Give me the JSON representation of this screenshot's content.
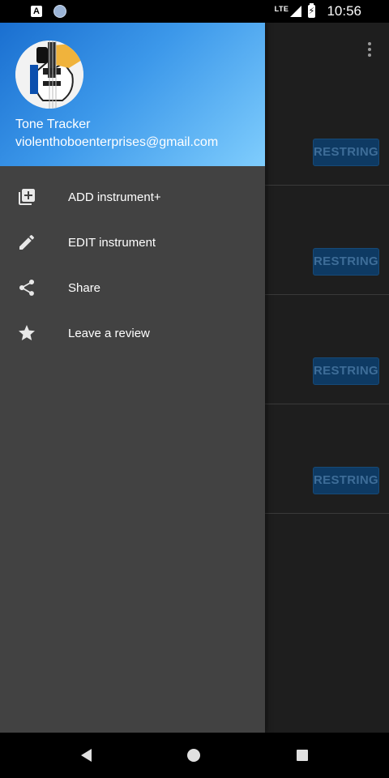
{
  "status_bar": {
    "time": "10:56",
    "network": "LTE",
    "icons": [
      "notification-a-icon",
      "sync-circle-icon",
      "lte-icon",
      "signal-icon",
      "battery-charging-icon"
    ]
  },
  "background_app": {
    "rows": [
      {
        "button_label": "RESTRING"
      },
      {
        "button_label": "RESTRING"
      },
      {
        "button_label": "RESTRING"
      },
      {
        "button_label": "RESTRING"
      }
    ],
    "overflow_menu_icon": "more-vert-icon"
  },
  "drawer": {
    "header": {
      "app_name": "Tone Tracker",
      "email": "violenthoboenterprises@gmail.com",
      "gradient_start": "#1a6fd0",
      "gradient_end": "#7fcdfd"
    },
    "items": [
      {
        "label": "ADD instrument+",
        "icon": "add-box-icon"
      },
      {
        "label": "EDIT instrument",
        "icon": "pencil-icon"
      },
      {
        "label": "Share",
        "icon": "share-icon"
      },
      {
        "label": "Leave a review",
        "icon": "star-icon"
      }
    ],
    "background": "#424242"
  },
  "nav_bar": {
    "buttons": [
      "back-icon",
      "home-icon",
      "recents-icon"
    ]
  },
  "colors": {
    "accent_button": "#0e3a63",
    "accent_button_text": "#3e6d98"
  }
}
